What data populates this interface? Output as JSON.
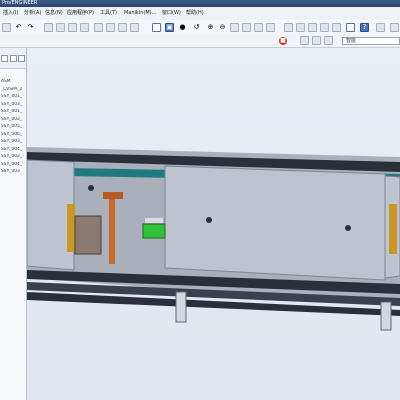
{
  "window": {
    "title": "Pro/ENGINEER"
  },
  "menu": [
    {
      "label": "插入(I)",
      "icon": ""
    },
    {
      "label": "分析(A)",
      "icon": ""
    },
    {
      "label": "信息(N)",
      "icon": ""
    },
    {
      "label": "应用程序(P)",
      "icon": ""
    },
    {
      "label": "工具(T)",
      "icon": ""
    },
    {
      "label": "Manikin(M)...",
      "icon": ""
    },
    {
      "label": "窗口(W)",
      "icon": ""
    },
    {
      "label": "帮助(H)",
      "icon": ""
    }
  ],
  "toolbar2": {
    "search_placeholder": "智能"
  },
  "model_tree": {
    "items": [
      "ASM",
      "_CVSPA_2",
      "SSY_001_",
      "SSY_003_",
      "SSY_001_",
      "SSY_002_",
      "SSY_005_",
      "SSY_006_",
      "SSY_003_",
      "SSY_004_",
      "SSY_002_",
      "SSY_004_",
      "SSY_003"
    ]
  },
  "colors": {
    "plate": "#bdc3cf",
    "rail_dark": "#2a2f3a",
    "teal": "#1f7a80",
    "orange": "#c86a2e",
    "green": "#32c23a",
    "amber": "#c99728"
  },
  "icons": {
    "toolbar": [
      "undo-icon",
      "redo-icon",
      "cut-icon",
      "copy-icon",
      "paste-icon",
      "regenerate-icon",
      "select-icon",
      "zoom-icon",
      "orient-icon",
      "datum-icon"
    ]
  }
}
